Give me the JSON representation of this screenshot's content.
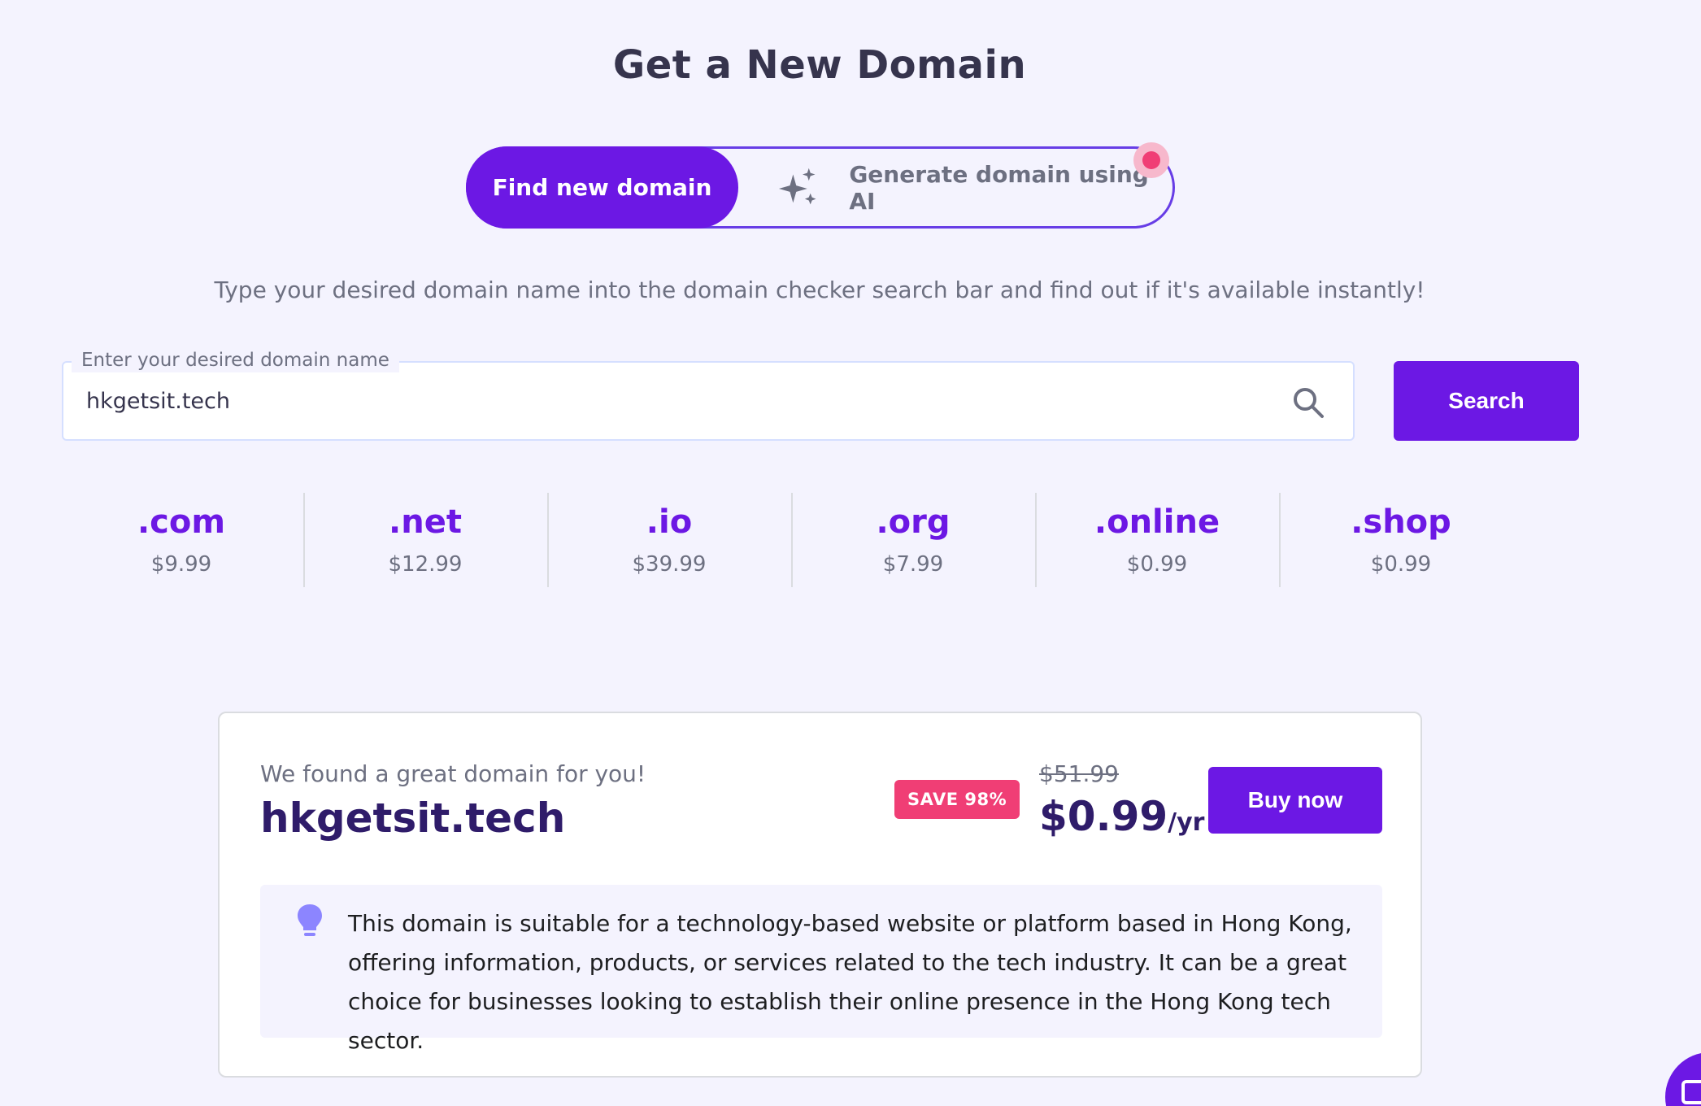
{
  "header": {
    "title": "Get a New Domain"
  },
  "toggle": {
    "find_label": "Find new domain",
    "ai_label": "Generate domain using AI"
  },
  "subtitle": "Type your desired domain name into the domain checker search bar and find out if it's available instantly!",
  "search": {
    "legend": "Enter your desired domain name",
    "value": "hkgetsit.tech",
    "button_label": "Search"
  },
  "tlds": [
    {
      "name": ".com",
      "price": "$9.99"
    },
    {
      "name": ".net",
      "price": "$12.99"
    },
    {
      "name": ".io",
      "price": "$39.99"
    },
    {
      "name": ".org",
      "price": "$7.99"
    },
    {
      "name": ".online",
      "price": "$0.99"
    },
    {
      "name": ".shop",
      "price": "$0.99"
    }
  ],
  "result": {
    "label": "We found a great domain for you!",
    "domain": "hkgetsit.tech",
    "badge": "SAVE 98%",
    "old_price": "$51.99",
    "price": "$0.99",
    "period": "/yr",
    "buy_label": "Buy now",
    "tip": "This domain is suitable for a technology-based website or platform based in Hong Kong, offering information, products, or services related to the tech industry. It can be a great choice for businesses looking to establish their online presence in the Hong Kong tech sector."
  },
  "colors": {
    "accent": "#6c18e4",
    "badge": "#f03e75",
    "background": "#f4f3fe"
  },
  "icons": {
    "ai": "sparkle-icon",
    "search": "search-icon",
    "tip": "bulb-icon",
    "chat": "chat-icon"
  }
}
